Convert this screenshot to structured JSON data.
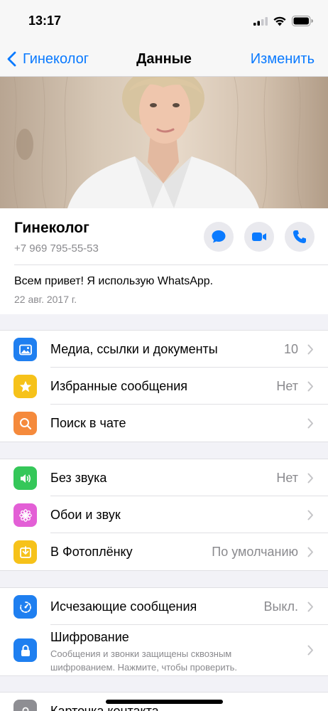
{
  "status_bar": {
    "time": "13:17"
  },
  "nav": {
    "back_label": "Гинеколог",
    "title": "Данные",
    "edit_label": "Изменить"
  },
  "contact": {
    "name": "Гинеколог",
    "phone": "+7 969 795-55-53",
    "about": "Всем привет! Я использую WhatsApp.",
    "about_date": "22 авг. 2017 г."
  },
  "actions": [
    "message-icon",
    "video-call-icon",
    "voice-call-icon"
  ],
  "groups": {
    "media": [
      {
        "label": "Медиа, ссылки и документы",
        "value": "10",
        "icon": "photo-icon",
        "color": "#1f7ff0"
      },
      {
        "label": "Избранные сообщения",
        "value": "Нет",
        "icon": "star-icon",
        "color": "#f6c21a"
      },
      {
        "label": "Поиск в чате",
        "value": "",
        "icon": "search-icon",
        "color": "#f58a3c"
      }
    ],
    "settings": [
      {
        "label": "Без звука",
        "value": "Нет",
        "icon": "speaker-icon",
        "color": "#35c759"
      },
      {
        "label": "Обои и звук",
        "value": "",
        "icon": "flower-icon",
        "color": "#e35fd6"
      },
      {
        "label": "В Фотоплёнку",
        "value": "По умолчанию",
        "icon": "save-to-photos-icon",
        "color": "#f6c21a"
      }
    ],
    "privacy": [
      {
        "label": "Исчезающие сообщения",
        "value": "Выкл.",
        "icon": "timer-icon",
        "color": "#1f7ff0"
      },
      {
        "label": "Шифрование",
        "sub": "Сообщения и звонки защищены сквозным шифрованием. Нажмите, чтобы проверить.",
        "icon": "lock-icon",
        "color": "#1f7ff0"
      }
    ],
    "contact_card": [
      {
        "label": "Карточка контакта",
        "icon": "contact-card-icon",
        "color": "#8e8e93"
      }
    ]
  }
}
